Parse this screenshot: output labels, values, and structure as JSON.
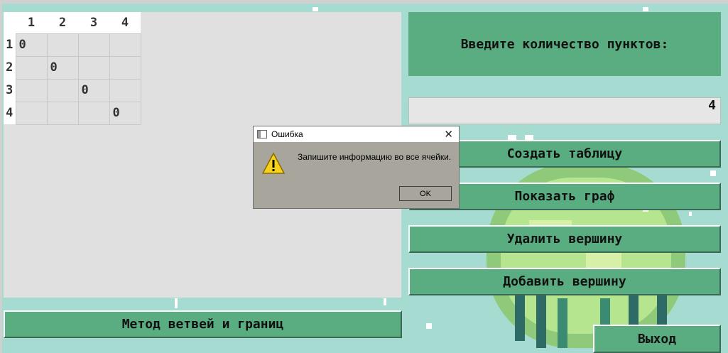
{
  "table": {
    "columns": [
      "1",
      "2",
      "3",
      "4"
    ],
    "rows": [
      {
        "header": "1",
        "cells": [
          "0",
          "",
          "",
          ""
        ]
      },
      {
        "header": "2",
        "cells": [
          "",
          "0",
          "",
          ""
        ]
      },
      {
        "header": "3",
        "cells": [
          "",
          "",
          "0",
          ""
        ]
      },
      {
        "header": "4",
        "cells": [
          "",
          "",
          "",
          "0"
        ]
      }
    ]
  },
  "right_panel": {
    "prompt_label": "Введите количество пунктов:",
    "count_value": "4",
    "buttons": {
      "create_table": "Создать таблицу",
      "show_graph": "Показать граф",
      "delete_vertex": "Удалить вершину",
      "add_vertex": "Добавить вершину",
      "exit": "Выход"
    }
  },
  "bottom": {
    "branch_and_bound": "Метод ветвей и границ"
  },
  "dialog": {
    "title": "Ошибка",
    "message": "Запишите информацию во все ячейки.",
    "ok": "OK",
    "close_symbol": "✕",
    "icon": "warning-icon"
  },
  "colors": {
    "background": "#a6dbd2",
    "button": "#59ad80",
    "panel": "#e0e0e0",
    "dialog": "#a7a59c"
  }
}
